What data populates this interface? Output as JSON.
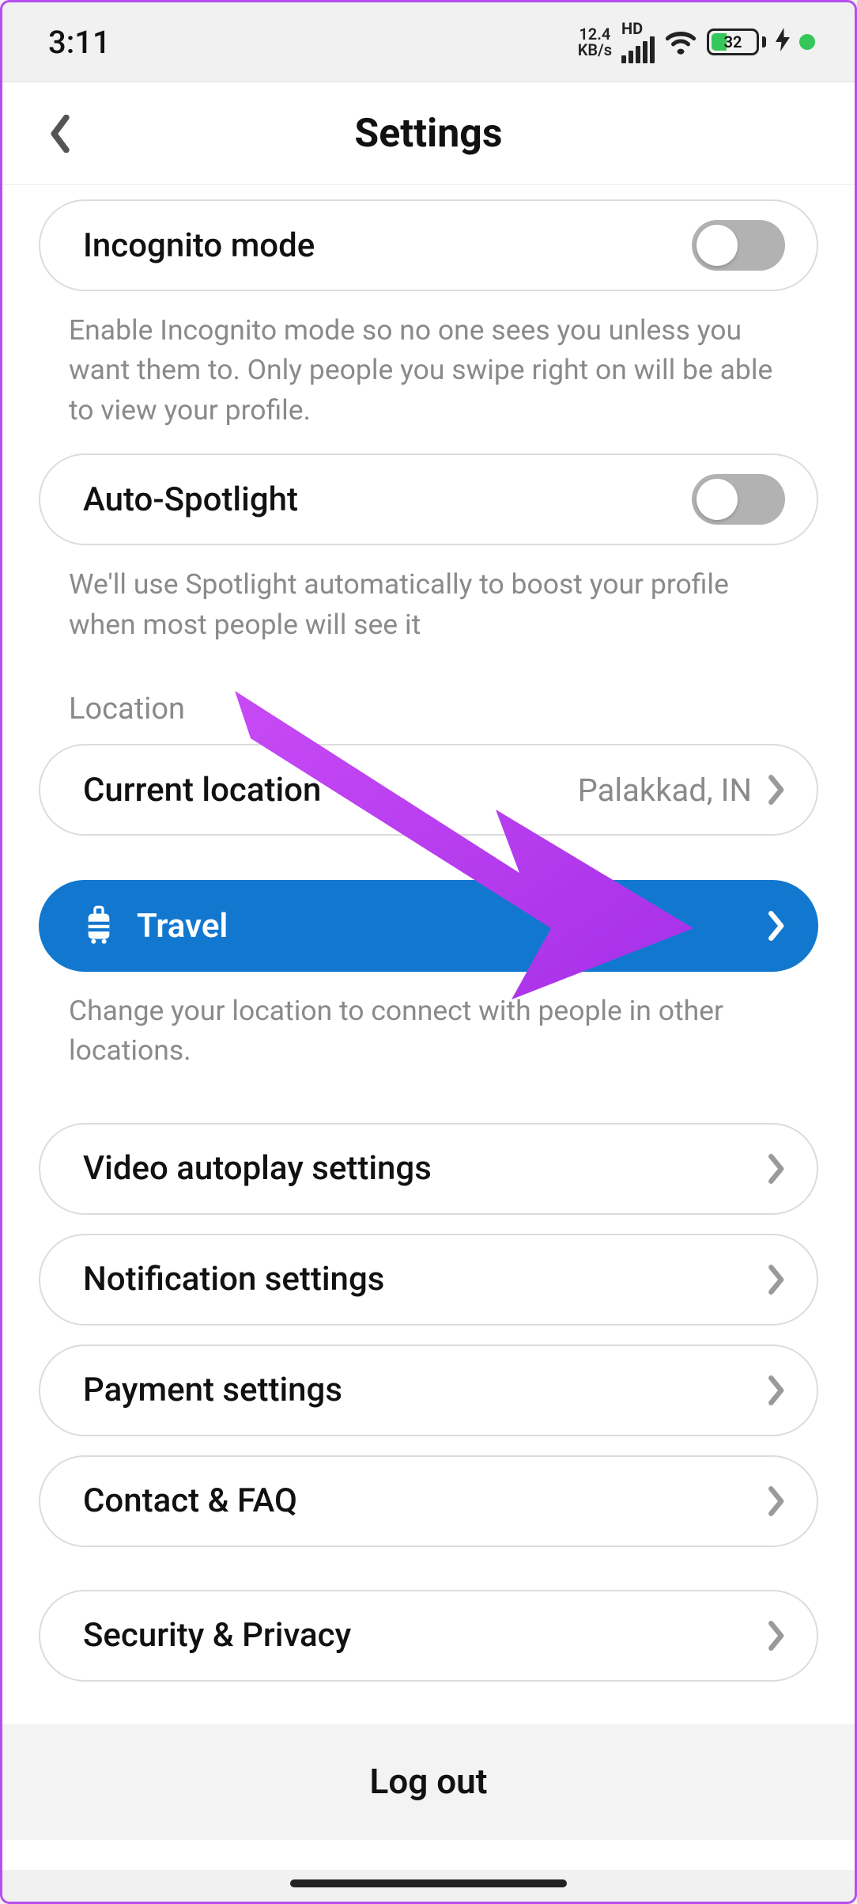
{
  "status_bar": {
    "time": "3:11",
    "kbs_value": "12.4",
    "kbs_unit": "KB/s",
    "hd": "HD",
    "battery_percent": "32"
  },
  "header": {
    "title": "Settings"
  },
  "incognito": {
    "label": "Incognito mode",
    "on": false,
    "desc": "Enable Incognito mode so no one sees you unless you want them to. Only people you swipe right on will be able to view your profile."
  },
  "auto_spotlight": {
    "label": "Auto-Spotlight",
    "on": false,
    "desc": "We'll use Spotlight automatically to boost your profile when most people will see it"
  },
  "location": {
    "section_label": "Location",
    "current_label": "Current location",
    "current_value": "Palakkad, IN",
    "travel_label": "Travel",
    "travel_desc": "Change your location to connect with people in other locations."
  },
  "rows": {
    "video": "Video autoplay settings",
    "notifications": "Notification settings",
    "payment": "Payment settings",
    "contact": "Contact & FAQ",
    "security": "Security & Privacy"
  },
  "logout_label": "Log out",
  "colors": {
    "accent_blue": "#1278cf",
    "annotation_purple": "#b23ef0",
    "battery_green": "#35c759"
  }
}
